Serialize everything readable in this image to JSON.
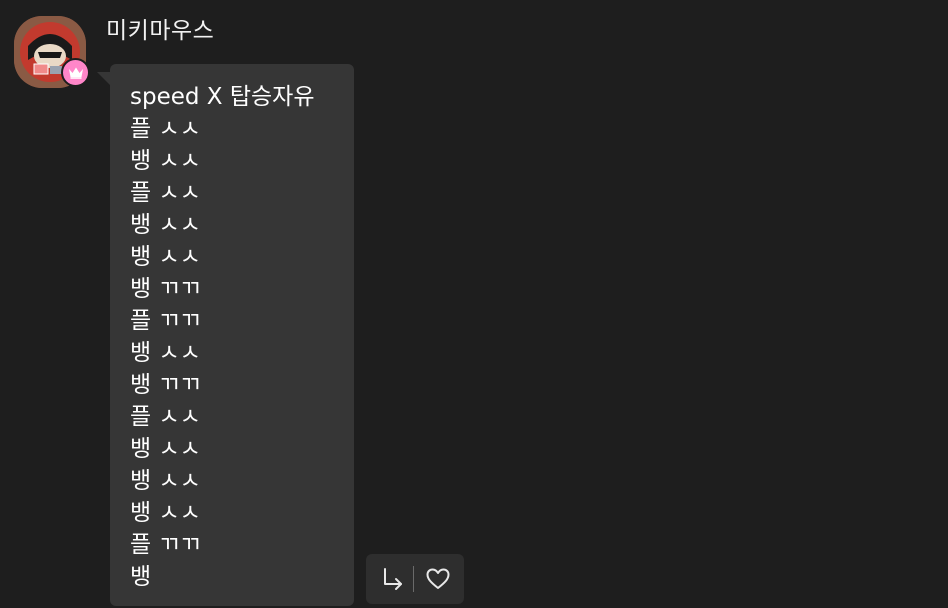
{
  "message": {
    "sender_name": "미키마우스",
    "lines": [
      "speed X 탑승자유",
      "플 ㅅㅅ",
      "뱅 ㅅㅅ",
      "플 ㅅㅅ",
      "뱅 ㅅㅅ",
      "뱅 ㅅㅅ",
      "뱅 ㄲㄲ",
      "플 ㄲㄲ",
      "뱅 ㅅㅅ",
      "뱅 ㄲㄲ",
      "플 ㅅㅅ",
      "뱅 ㅅㅅ",
      "뱅 ㅅㅅ",
      "뱅 ㅅㅅ",
      "플 ㄲㄲ",
      "뱅"
    ]
  },
  "icons": {
    "avatar": "avatar-image",
    "badge": "crown-icon",
    "reply": "reply-arrow-icon",
    "like": "heart-icon"
  },
  "colors": {
    "background": "#1e1e1e",
    "bubble": "#363636",
    "badge": "#ff86c9",
    "text": "#ffffff"
  }
}
